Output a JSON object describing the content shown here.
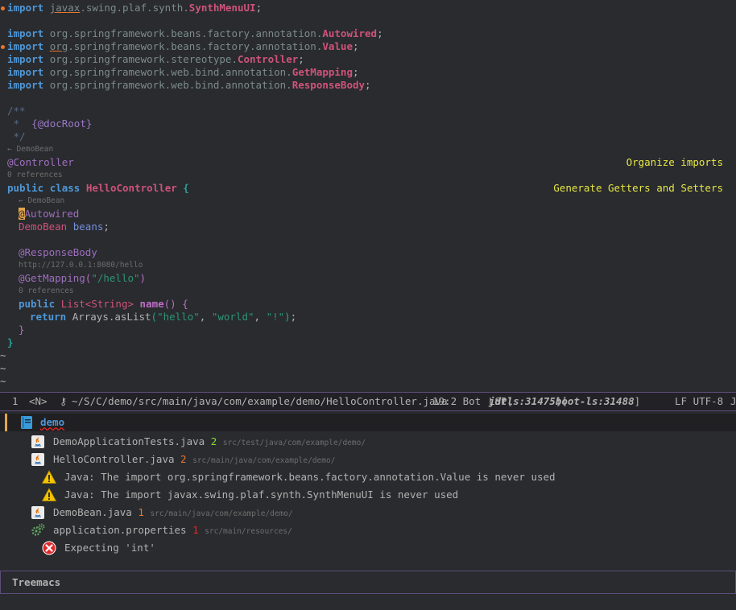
{
  "editor": {
    "imports": {
      "kw": "import",
      "l1_pkg": "javax.swing.plaf.synth.",
      "l1_pkg_head": "javax",
      "l1_pkg_rest": ".swing.plaf.synth.",
      "l1_cls": "SynthMenuUI",
      "l2_pkg": "org.springframework.beans.factory.annotation.",
      "l2_cls": "Autowired",
      "l3_pkg_head": "org",
      "l3_pkg_rest": ".springframework.beans.factory.annotation.",
      "l3_cls": "Value",
      "l4_pkg": "org.springframework.stereotype.",
      "l4_cls": "Controller",
      "l5_pkg": "org.springframework.web.bind.annotation.",
      "l5_cls": "GetMapping",
      "l6_pkg": "org.springframework.web.bind.annotation.",
      "l6_cls": "ResponseBody",
      "semi": ";"
    },
    "javadoc": {
      "open": "/**",
      "star": " *",
      "tag": "{@docRoot}",
      "close": " */"
    },
    "lens_demobean": "← DemoBean",
    "controller_ann": "@Controller",
    "refs": "0 references",
    "class_line": {
      "kw_public": "public",
      "kw_class": "class",
      "name": "HelloController",
      "brace": "{"
    },
    "actions": {
      "organize": "Organize imports",
      "getters": "Generate Getters and Setters"
    },
    "field": {
      "ann_cursor": "@",
      "ann_rest": "Autowired",
      "type": "DemoBean",
      "name": "beans",
      "semi": ";"
    },
    "method": {
      "ann1": "@ResponseBody",
      "url": "http://127.0.0.1:8080/hello",
      "ann2": "@GetMapping",
      "ann2_open": "(",
      "ann2_str": "\"/hello\"",
      "ann2_close": ")",
      "refs": "0 references",
      "kw_public": "public",
      "type_list": "List",
      "lt": "<",
      "type_string": "String",
      "gt": ">",
      "name": "name",
      "parens": "()",
      "brace": "{",
      "kw_return": "return",
      "call": "Arrays.asList",
      "paren_open": "(",
      "s1": "\"hello\"",
      "comma": ",",
      "s2": "\"world\"",
      "s3": "\"!\"",
      "paren_close": ")",
      "semi": ";",
      "close_brace": "}"
    },
    "class_close": "}",
    "tilde": "~"
  },
  "modeline": {
    "window_num": "1",
    "state": "<N>",
    "lock": "⚷",
    "path": "~/S/C/demo/src/main/java/com/example/demo/HelloController.java",
    "position": "19:2 Bot",
    "lsp_prefix": "LSP[",
    "lsp1": "jdtls:31475",
    "lsp_mid": "][",
    "lsp2": "boot-ls:31488",
    "lsp_suffix": "]",
    "encoding": "LF UTF-8",
    "mode": "J"
  },
  "treemacs": {
    "root": "demo",
    "files": [
      {
        "name": "DemoApplicationTests.java",
        "count": "2",
        "path": "src/test/java/com/example/demo/",
        "icon": "java-icon"
      },
      {
        "name": "HelloController.java",
        "count": "2",
        "path": "src/main/java/com/example/demo/",
        "icon": "java-icon"
      },
      {
        "name": "DemoBean.java",
        "count": "1",
        "path": "src/main/java/com/example/demo/",
        "icon": "java-icon"
      },
      {
        "name": "application.properties",
        "count": "1",
        "path": "src/main/resources/",
        "icon": "gears-icon"
      }
    ],
    "diagnostics": [
      "Java: The import org.springframework.beans.factory.annotation.Value is never used",
      "Java: The import javax.swing.plaf.synth.SynthMenuUI is never used",
      "Expecting 'int'"
    ],
    "footer": "Treemacs"
  },
  "colors": {
    "background": "#292b2e",
    "keyword": "#4f97d7",
    "class": "#ce537a",
    "string": "#2d9574",
    "action": "#e6e646",
    "border": "#5d4d7a"
  }
}
